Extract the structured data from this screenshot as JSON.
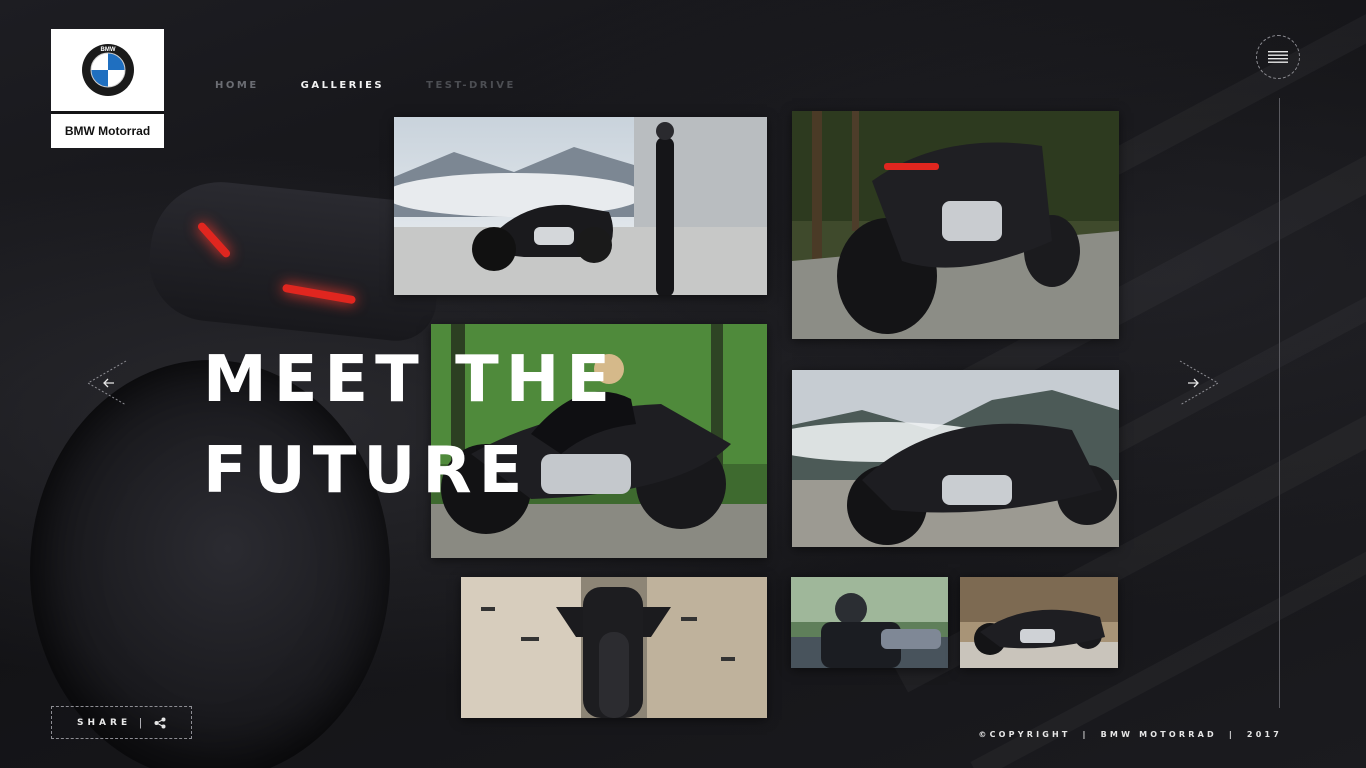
{
  "brand": {
    "logo_icon": "bmw-roundel",
    "name": "BMW Motorrad",
    "colors": {
      "blue": "#1f6fc0",
      "ring": "#1a1a1a",
      "white": "#ffffff"
    }
  },
  "nav": {
    "items": [
      {
        "label": "HOME"
      },
      {
        "label": "GALLERIES"
      },
      {
        "label": "TEST-DRIVE"
      }
    ],
    "active": "GALLERIES"
  },
  "menu_icon": "hamburger-icon",
  "hero": {
    "line1": "MEET THE",
    "line2": "FUTURE"
  },
  "arrows": {
    "prev_icon": "arrow-left-icon",
    "next_icon": "arrow-right-icon"
  },
  "gallery": [
    {
      "subject": "motorcycle-with-rider-standing-mist-mountains"
    },
    {
      "subject": "motorcycle-rear-view-red-taillight-forest"
    },
    {
      "subject": "rider-on-motorcycle-forest-motion"
    },
    {
      "subject": "motorcycle-side-view-mountains"
    },
    {
      "subject": "motorcycle-front-view-corridor"
    },
    {
      "subject": "rider-helmet-closeup"
    },
    {
      "subject": "motorcycle-studio-side-view"
    }
  ],
  "share": {
    "label": "SHARE",
    "separator": "|",
    "icon": "share-icon"
  },
  "footer": {
    "text": "©COPYRIGHT  |  BMW MOTORRAD  |  2017"
  },
  "accent": {
    "taillight_red": "#e0261f",
    "text_white": "#ffffff",
    "nav_grey": "#6b6d73"
  }
}
